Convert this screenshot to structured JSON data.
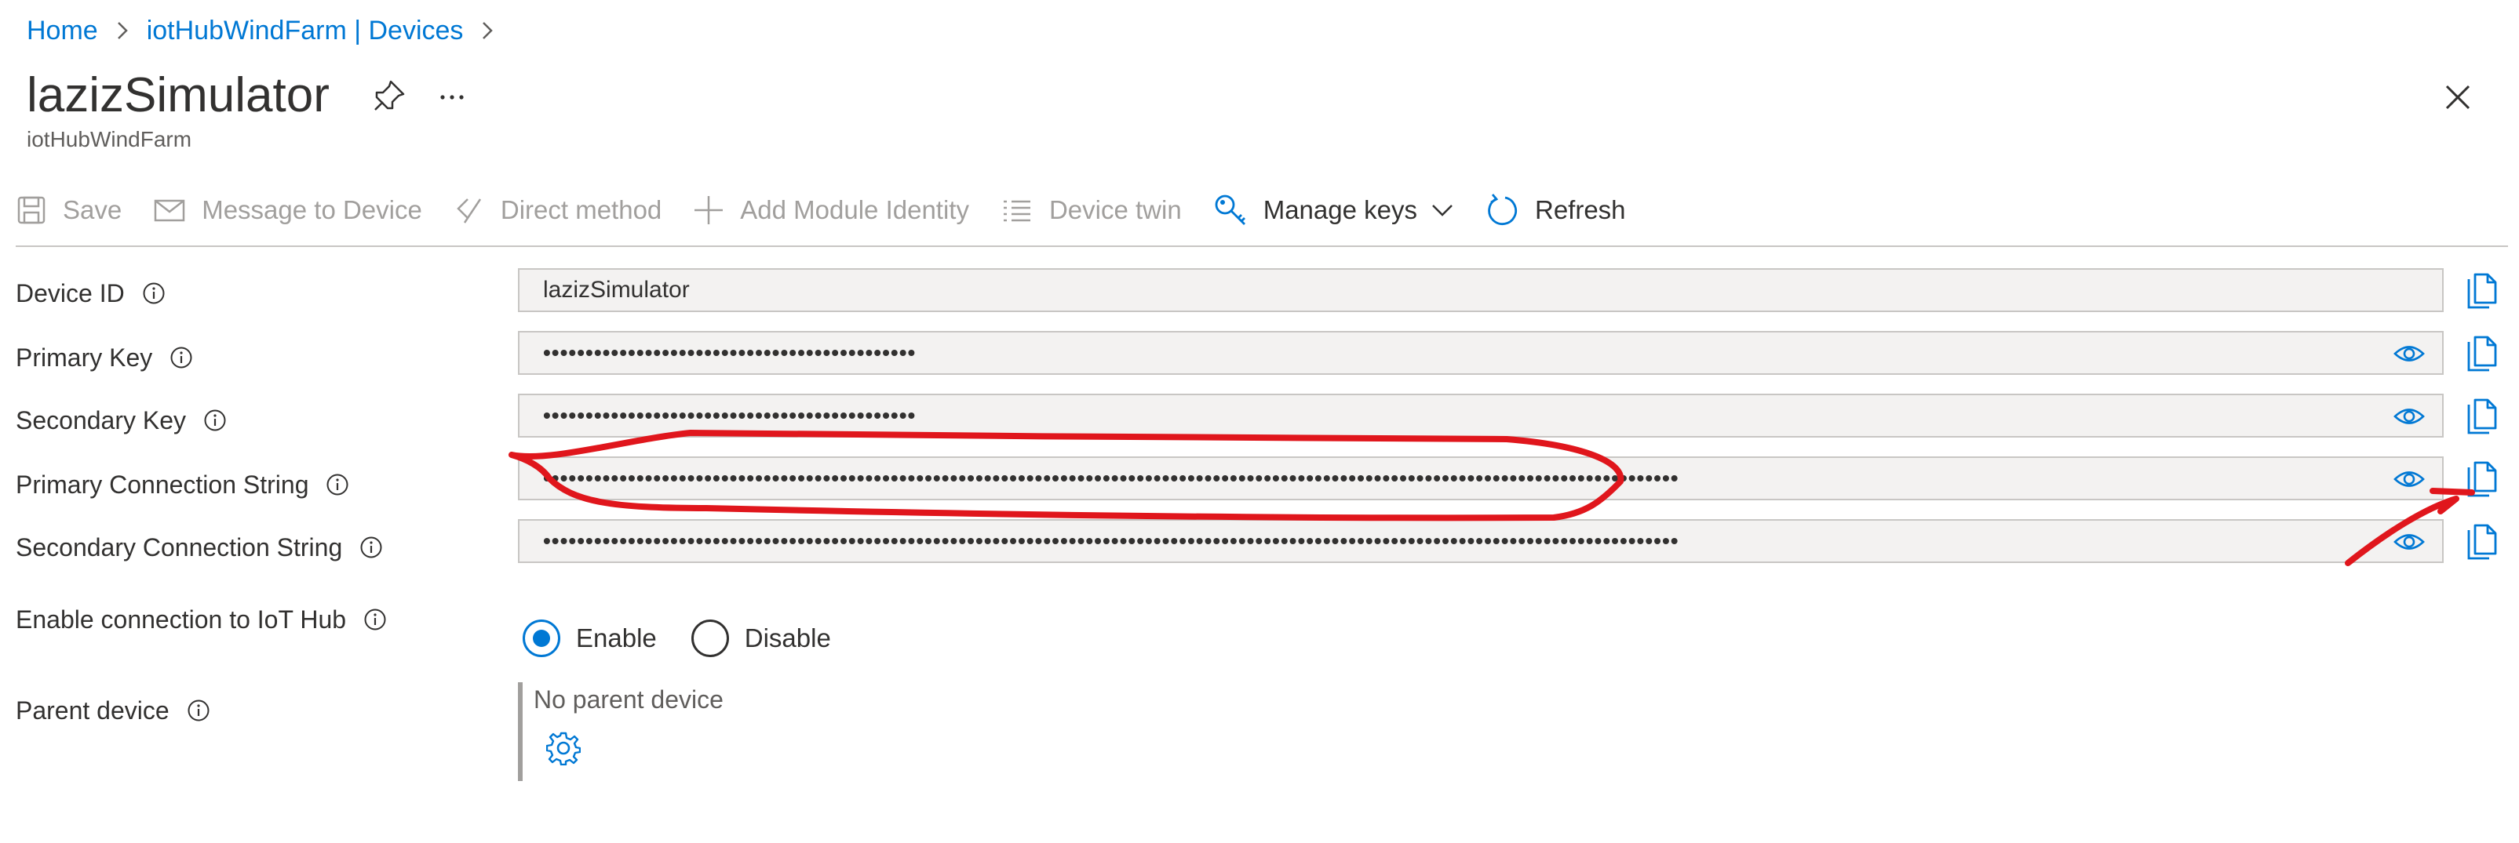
{
  "breadcrumb": {
    "items": [
      "Home",
      "iotHubWindFarm | Devices"
    ]
  },
  "header": {
    "title": "lazizSimulator",
    "subtitle": "iotHubWindFarm",
    "icons": [
      "pin-icon",
      "more-icon",
      "close-icon"
    ]
  },
  "toolbar": {
    "save": "Save",
    "message": "Message to Device",
    "direct_method": "Direct method",
    "add_module": "Add Module Identity",
    "device_twin": "Device twin",
    "manage_keys": "Manage keys",
    "refresh": "Refresh"
  },
  "form": {
    "device_id": {
      "label": "Device ID",
      "value": "lazizSimulator"
    },
    "primary_key": {
      "label": "Primary Key",
      "value": "••••••••••••••••••••••••••••••••••••••••••••"
    },
    "secondary_key": {
      "label": "Secondary Key",
      "value": "••••••••••••••••••••••••••••••••••••••••••••"
    },
    "primary_conn": {
      "label": "Primary Connection String",
      "value": "••••••••••••••••••••••••••••••••••••••••••••••••••••••••••••••••••••••••••••••••••••••••••••••••••••••••••••••••••••••••••••••••••••••"
    },
    "secondary_conn": {
      "label": "Secondary Connection String",
      "value": "••••••••••••••••••••••••••••••••••••••••••••••••••••••••••••••••••••••••••••••••••••••••••••••••••••••••••••••••••••••••••••••••••••••"
    },
    "enable_conn": {
      "label": "Enable connection to IoT Hub",
      "options": [
        "Enable",
        "Disable"
      ],
      "selected": "Enable"
    },
    "parent_device": {
      "label": "Parent device",
      "value": "No parent device"
    }
  },
  "colors": {
    "accent": "#0078d4",
    "annotation": "#e0161c",
    "disabled_text": "#a19f9d"
  }
}
